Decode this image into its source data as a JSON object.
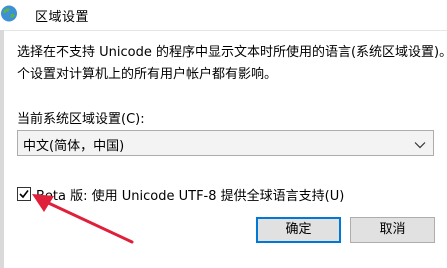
{
  "window": {
    "title": "区域设置",
    "icon": "globe-icon"
  },
  "description": [
    "选择在不支持 Unicode 的程序中显示文本时所使用的语言(系统区域设置)。这",
    "个设置对计算机上的所有用户帐户都有影响。"
  ],
  "locale": {
    "label": "当前系统区域设置(C):",
    "selected": "中文(简体，中国)"
  },
  "beta_option": {
    "checked": true,
    "label": "Beta 版: 使用 Unicode UTF-8 提供全球语言支持(U)"
  },
  "buttons": {
    "ok": "确定",
    "cancel": "取消"
  },
  "colors": {
    "accent": "#0078d7",
    "annotation_arrow": "#e0203a"
  }
}
